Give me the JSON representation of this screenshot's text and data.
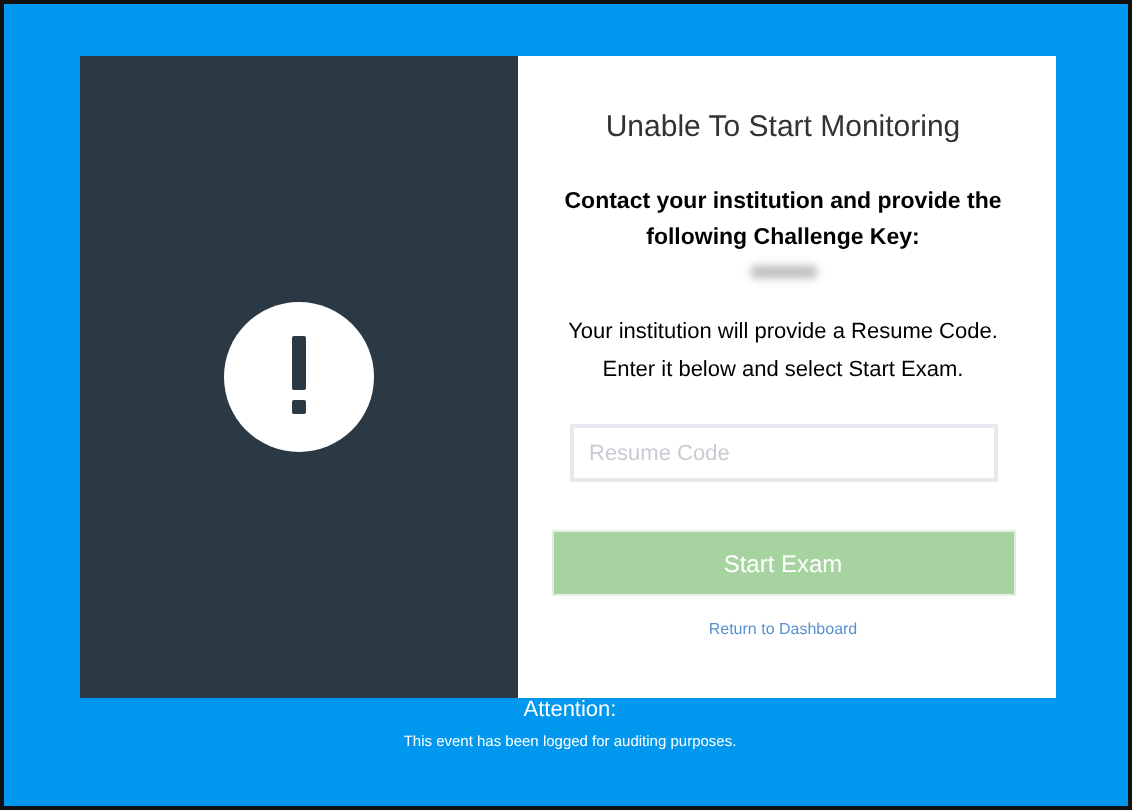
{
  "dialog": {
    "title": "Unable To Start Monitoring",
    "instruction": "Contact your institution and provide the following Challenge Key:",
    "info_lines": [
      "Your institution will provide a Resume Code.",
      "Enter it below and select Start Exam."
    ],
    "resume_field": {
      "placeholder": "Resume Code"
    },
    "start_button": {
      "label": "Start Exam",
      "disabled": true
    },
    "dashboard_link": "Return to Dashboard"
  },
  "footer": {
    "heading": "Attention:",
    "message": "This event has been logged for auditing purposes."
  }
}
